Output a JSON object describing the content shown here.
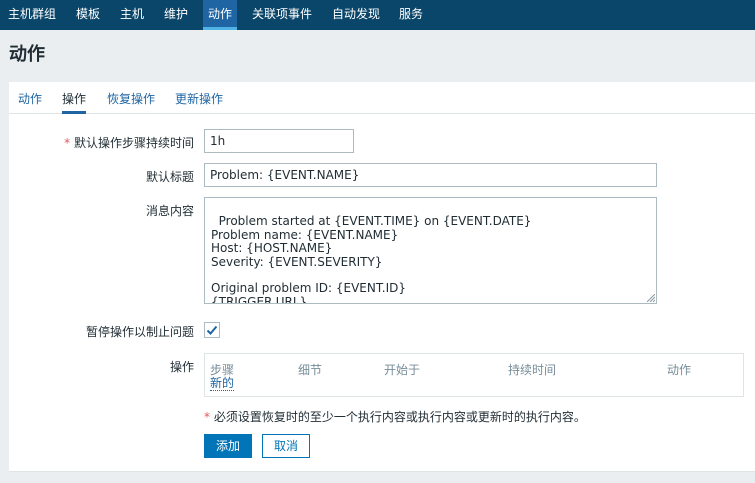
{
  "nav": {
    "items": [
      {
        "label": "主机群组"
      },
      {
        "label": "模板"
      },
      {
        "label": "主机"
      },
      {
        "label": "维护"
      },
      {
        "label": "动作"
      },
      {
        "label": "关联项事件"
      },
      {
        "label": "自动发现"
      },
      {
        "label": "服务"
      }
    ],
    "active_index": 4
  },
  "page": {
    "title": "动作"
  },
  "tabs": [
    {
      "label": "动作"
    },
    {
      "label": "操作"
    },
    {
      "label": "恢复操作"
    },
    {
      "label": "更新操作"
    }
  ],
  "form": {
    "step_duration": {
      "required_mark": "*",
      "label": "默认操作步骤持续时间",
      "value": "1h"
    },
    "default_subject": {
      "label": "默认标题",
      "value": "Problem: {EVENT.NAME}"
    },
    "message": {
      "label": "消息内容",
      "value": "Problem started at {EVENT.TIME} on {EVENT.DATE}\nProblem name: {EVENT.NAME}\nHost: {HOST.NAME}\nSeverity: {EVENT.SEVERITY}\n\nOriginal problem ID: {EVENT.ID}\n{TRIGGER.URL}"
    },
    "pause_suppressed": {
      "label": "暂停操作以制止问题",
      "checked": true
    },
    "operations": {
      "label": "操作",
      "columns": [
        "步骤",
        "细节",
        "开始于",
        "持续时间",
        "动作"
      ],
      "new_link": "新的"
    },
    "note": {
      "mark": "*",
      "text": "必须设置恢复时的至少一个执行内容或执行内容或更新时的执行内容。"
    }
  },
  "buttons": {
    "add": "添加",
    "cancel": "取消"
  },
  "colors": {
    "nav_bg": "#0a466a",
    "nav_active": "#1f65a3",
    "link": "#1f65a3",
    "primary": "#0275b8",
    "required": "#e45959"
  }
}
